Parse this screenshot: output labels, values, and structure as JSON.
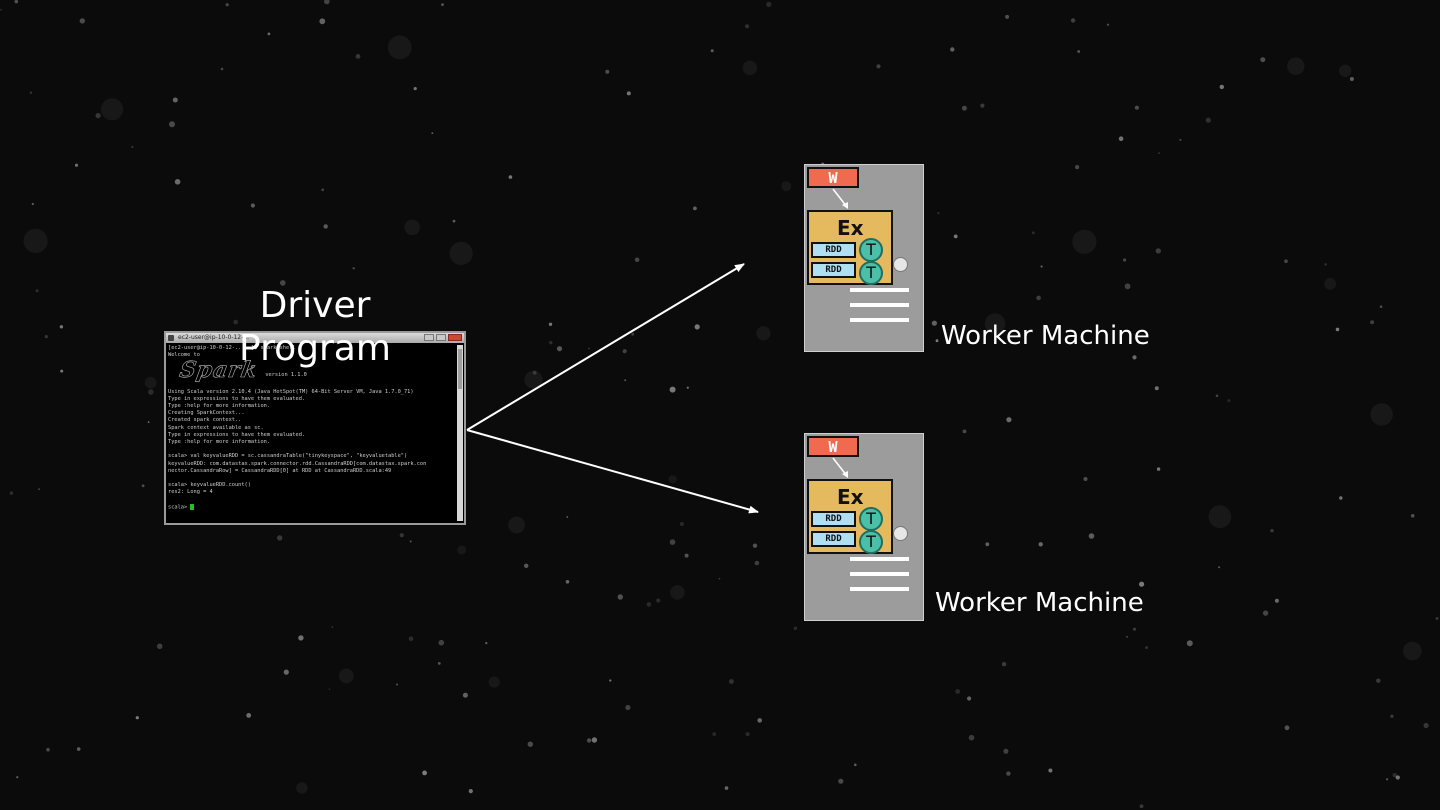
{
  "driver": {
    "title_line1": "Driver",
    "title_line2": "Program",
    "terminal": {
      "window_title": "ec2-user@ip-10-0-12-...",
      "lines_top": [
        "[ec2-user@ip-10-0-12-... ~]$ spark-shell",
        "Welcome to"
      ],
      "logo_text": "Spark",
      "version_text": "version 1.1.0",
      "lines_bottom": [
        "",
        "Using Scala version 2.10.4 (Java HotSpot(TM) 64-Bit Server VM, Java 1.7.0_71)",
        "Type in expressions to have them evaluated.",
        "Type :help for more information.",
        "Creating SparkContext...",
        "Created spark context..",
        "Spark context available as sc.",
        "Type in expressions to have them evaluated.",
        "Type :help for more information.",
        "",
        "scala> val keyvalueRDD = sc.cassandraTable(\"tinykeyspace\", \"keyvaluetable\")",
        "keyvalueRDD: com.datastax.spark.connector.rdd.CassandraRDD[com.datastax.spark.con",
        "nector.CassandraRow] = CassandraRDD[0] at RDD at CassandraRDD.scala:49",
        "",
        "scala> keyvalueRDD.count()",
        "res2: Long = 4",
        ""
      ],
      "prompt": "scala> "
    }
  },
  "workers": [
    {
      "label": "Worker Machine",
      "worker_badge": "W",
      "executor_label": "Ex",
      "rdd_labels": [
        "RDD",
        "RDD"
      ],
      "task_labels": [
        "T",
        "T"
      ]
    },
    {
      "label": "Worker Machine",
      "worker_badge": "W",
      "executor_label": "Ex",
      "rdd_labels": [
        "RDD",
        "RDD"
      ],
      "task_labels": [
        "T",
        "T"
      ]
    }
  ],
  "colors": {
    "background": "#0b0b0b",
    "worker_fill": "#9c9c9c",
    "worker_badge": "#f06a50",
    "executor_fill": "#e5b95e",
    "rdd_fill": "#aedff2",
    "task_fill": "#4bbfa8",
    "arrow": "#ffffff"
  }
}
